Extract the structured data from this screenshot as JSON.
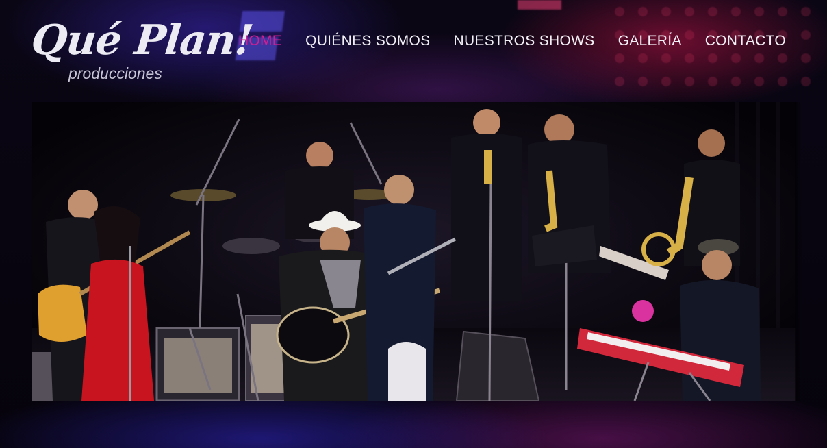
{
  "brand": {
    "logo_main": "Qué Plan!",
    "logo_sub": "producciones"
  },
  "nav": {
    "items": [
      {
        "label": "HOME",
        "active": true
      },
      {
        "label": "QUIÉNES SOMOS",
        "active": false
      },
      {
        "label": "NUESTROS SHOWS",
        "active": false
      },
      {
        "label": "GALERÍA",
        "active": false
      },
      {
        "label": "CONTACTO",
        "active": false
      }
    ]
  },
  "colors": {
    "active_nav": "#d21e91",
    "nav_text": "#f2f0f6",
    "background": "#07040f",
    "stage_blue": "#3a2ad0",
    "stage_red": "#c8143f",
    "dress_red": "#c8141e",
    "keyboard_red": "#d2283c"
  },
  "hero": {
    "image": "band-performing-on-stage"
  }
}
